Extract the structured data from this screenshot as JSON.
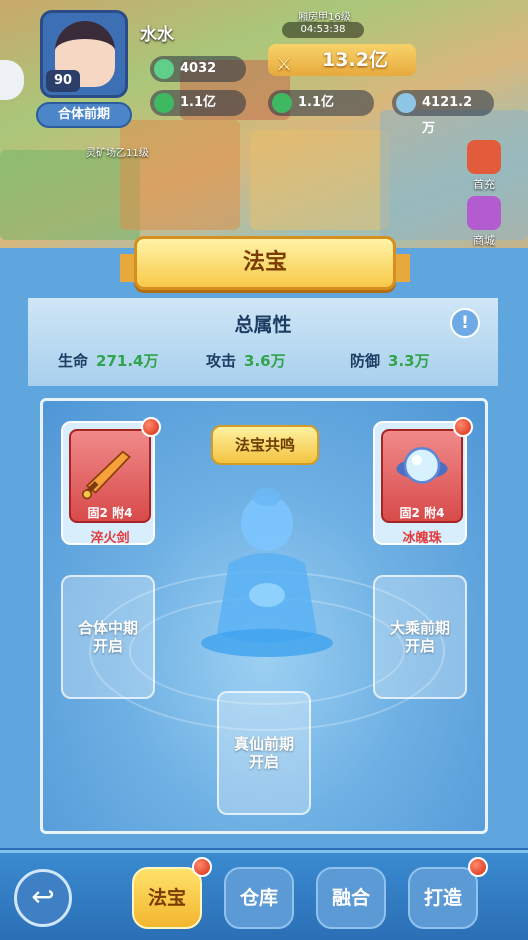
{
  "header": {
    "player_name": "水水",
    "level": "90",
    "realm": "合体前期",
    "timer_label": "04:53:38",
    "power": "13.2亿",
    "resources": [
      {
        "name": "gem",
        "value": "4032"
      },
      {
        "name": "copper",
        "value": "1.1亿"
      },
      {
        "name": "jade",
        "value": "1.1亿"
      },
      {
        "name": "crystal",
        "value": "4121.2万"
      }
    ],
    "map_labels": [
      "灵矿场乙11级",
      "厢房甲16级"
    ],
    "side_buttons": [
      {
        "label": "首充",
        "icon": "gift-chest-icon"
      },
      {
        "label": "商城",
        "icon": "shop-icon"
      }
    ]
  },
  "panel": {
    "title": "法宝",
    "stats_title": "总属性",
    "stats": [
      {
        "label": "生命",
        "value": "271.4万"
      },
      {
        "label": "攻击",
        "value": "3.6万"
      },
      {
        "label": "防御",
        "value": "3.3万"
      }
    ],
    "resonance_label": "法宝共鸣",
    "slots_filled": [
      {
        "name": "淬火剑",
        "tag_fixed": "固2",
        "tag_extra": "附4",
        "icon": "sword-icon"
      },
      {
        "name": "冰魄珠",
        "tag_fixed": "固2",
        "tag_extra": "附4",
        "icon": "ice-orb-icon"
      }
    ],
    "slots_locked": [
      {
        "label": "合体中期\n开启"
      },
      {
        "label": "大乘前期\n开启"
      },
      {
        "label": "真仙前期\n开启"
      }
    ]
  },
  "nav": {
    "items": [
      {
        "label": "法宝",
        "active": true,
        "badge": true
      },
      {
        "label": "仓库",
        "active": false,
        "badge": false
      },
      {
        "label": "融合",
        "active": false,
        "badge": false
      },
      {
        "label": "打造",
        "active": false,
        "badge": true
      }
    ]
  },
  "colors": {
    "panel_blue": "#5ea6dd",
    "stat_value_green": "#2fa44a",
    "slot_red": "#d84a4a",
    "ribbon_gold": "#f8c948"
  }
}
